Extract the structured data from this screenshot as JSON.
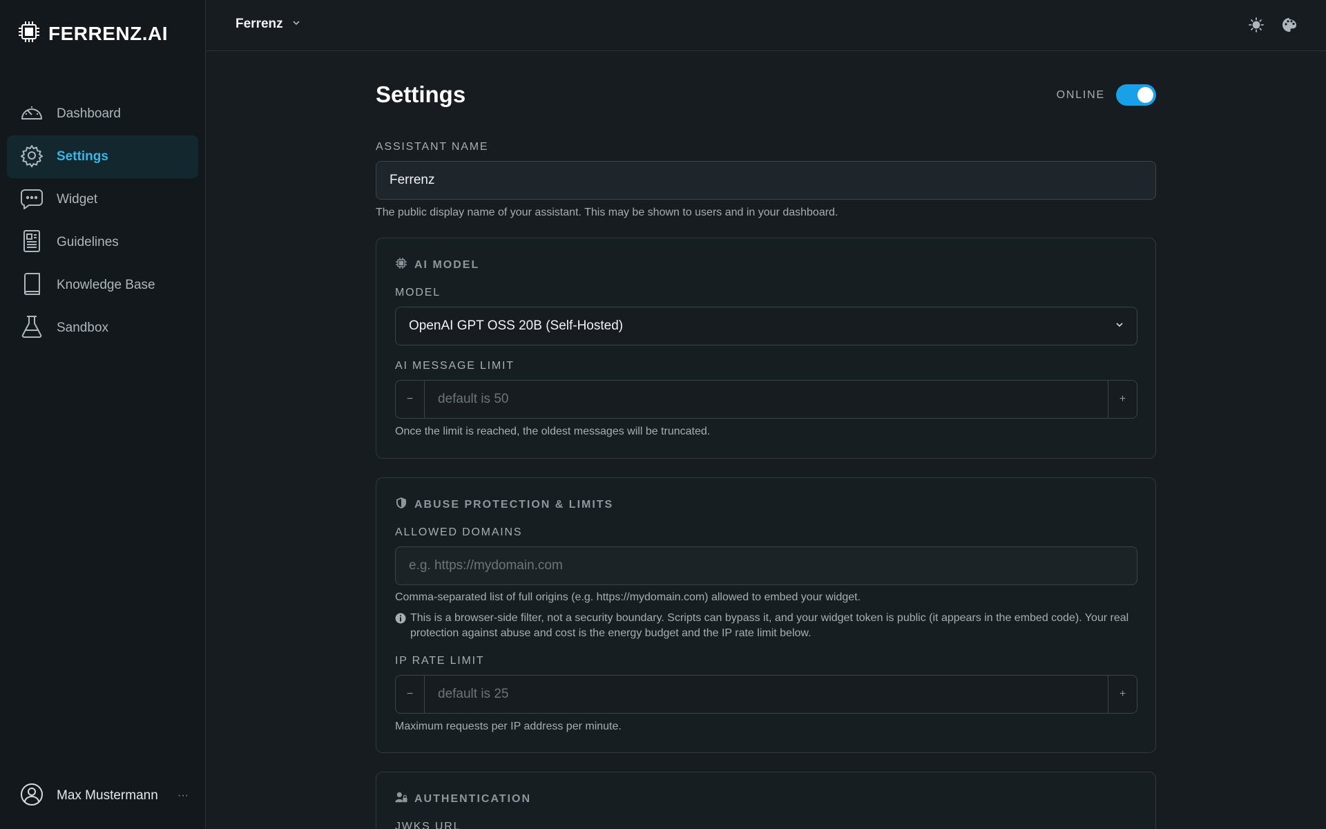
{
  "brand": {
    "name": "FERRENZ.AI"
  },
  "sidebar": {
    "items": [
      {
        "label": "Dashboard",
        "icon": "dashboard-icon"
      },
      {
        "label": "Settings",
        "icon": "gear-icon",
        "active": true
      },
      {
        "label": "Widget",
        "icon": "chat-bubble-icon"
      },
      {
        "label": "Guidelines",
        "icon": "document-icon"
      },
      {
        "label": "Knowledge Base",
        "icon": "book-icon"
      },
      {
        "label": "Sandbox",
        "icon": "flask-icon"
      }
    ],
    "user": {
      "name": "Max Mustermann",
      "more": "···"
    }
  },
  "topbar": {
    "workspace": "Ferrenz"
  },
  "page": {
    "title": "Settings",
    "status_label": "ONLINE",
    "online": true
  },
  "assistant": {
    "label": "ASSISTANT NAME",
    "value": "Ferrenz",
    "help": "The public display name of your assistant. This may be shown to users and in your dashboard."
  },
  "ai_model": {
    "title": "AI MODEL",
    "model_label": "MODEL",
    "model_value": "OpenAI GPT OSS 20B (Self-Hosted)",
    "limit_label": "AI MESSAGE LIMIT",
    "limit_placeholder": "default is 50",
    "limit_help": "Once the limit is reached, the oldest messages will be truncated.",
    "minus": "−",
    "plus": "+"
  },
  "abuse": {
    "title": "ABUSE PROTECTION & LIMITS",
    "domains_label": "ALLOWED DOMAINS",
    "domains_placeholder": "e.g. https://mydomain.com",
    "domains_help": "Comma-separated list of full origins (e.g. https://mydomain.com) allowed to embed your widget.",
    "domains_note": "This is a browser-side filter, not a security boundary. Scripts can bypass it, and your widget token is public (it appears in the embed code). Your real protection against abuse and cost is the energy budget and the IP rate limit below.",
    "rate_label": "IP RATE LIMIT",
    "rate_placeholder": "default is 25",
    "rate_help": "Maximum requests per IP address per minute.",
    "minus": "−",
    "plus": "+"
  },
  "auth": {
    "title": "AUTHENTICATION",
    "jwks_label": "JWKS URL"
  },
  "colors": {
    "accent": "#1aa0e6",
    "active_text": "#38b6e8",
    "background": "#161c20",
    "sidebar": "#12181c"
  }
}
